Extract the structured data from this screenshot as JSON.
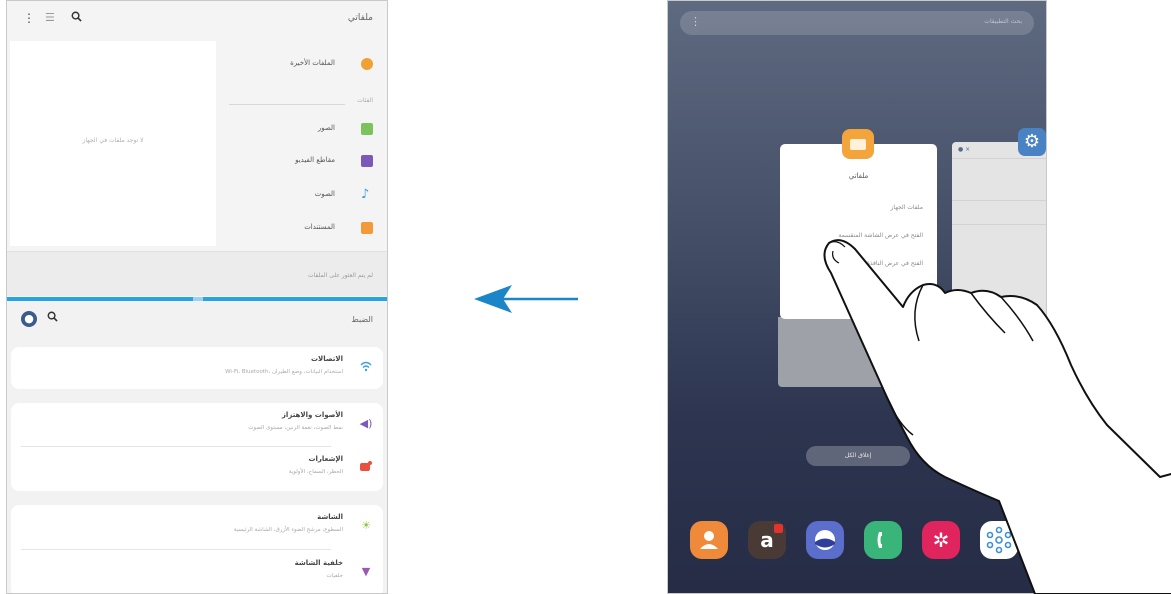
{
  "left_phone": {
    "files": {
      "title": "ملفاتي",
      "toolbar": {
        "more_icon": "more-vertical-icon",
        "list_icon": "list-view-icon",
        "search_icon": "search-icon"
      },
      "recent_label": "الملفات الأخيرة",
      "categories_header": "الفئات",
      "categories": [
        {
          "label": "الصور",
          "icon": "image-icon",
          "color": "#7cc35e"
        },
        {
          "label": "مقاطع الفيديو",
          "icon": "video-icon",
          "color": "#7b59b8"
        },
        {
          "label": "الصوت",
          "icon": "music-icon",
          "color": "#3c9ee5"
        },
        {
          "label": "المستندات",
          "icon": "document-icon",
          "color": "#f29a3a"
        }
      ],
      "preview_text": "لا توجد ملفات في الجهاز",
      "bottom_text": "لم يتم العثور على الملفات"
    },
    "settings": {
      "title": "الضبط",
      "cards": [
        {
          "items": [
            {
              "title": "الاتصالات",
              "subtitle": "Wi-Fi، Bluetooth، استخدام البيانات، وضع الطيران",
              "icon": "wifi-icon",
              "color": "#3c9ee5"
            }
          ]
        },
        {
          "items": [
            {
              "title": "الأصوات والاهتزاز",
              "subtitle": "نمط الصوت، نغمة الرنين، مستوى الصوت",
              "icon": "volume-icon",
              "color": "#7b59b8"
            },
            {
              "title": "الإشعارات",
              "subtitle": "الحظر، السماح، الأولوية",
              "icon": "notification-icon",
              "color": "#e9503f"
            }
          ]
        },
        {
          "items": [
            {
              "title": "الشاشة",
              "subtitle": "السطوع، مرشح الضوء الأزرق، الشاشة الرئيسية",
              "icon": "brightness-icon",
              "color": "#8cc63e"
            },
            {
              "title": "خلفية الشاشة",
              "subtitle": "خلفيات",
              "icon": "wallpaper-icon",
              "color": "#9b59b6"
            }
          ]
        }
      ]
    }
  },
  "arrow": {
    "color": "#1a86c8",
    "direction": "left"
  },
  "right_phone": {
    "search_placeholder": "بحث التطبيقات",
    "files_card": {
      "title": "ملفاتي",
      "lines": [
        "ملفات الجهاز",
        "الفتح في عرض الشاشة المنقسمة",
        "الفتح في عرض النافذة المنبثقة"
      ]
    },
    "close_all": "إغلاق الكل",
    "dock": [
      {
        "name": "contacts",
        "icon": "contacts-icon",
        "color": "#ee8a3a",
        "glyph": "👤"
      },
      {
        "name": "amazon",
        "icon": "amazon-icon",
        "color": "#4a3a35",
        "glyph": "a"
      },
      {
        "name": "internet",
        "icon": "internet-icon",
        "color": "#5b6ecc",
        "glyph": "◐"
      },
      {
        "name": "phone",
        "icon": "phone-icon",
        "color": "#39b57a",
        "glyph": "✆"
      },
      {
        "name": "galaxy-apps",
        "icon": "galaxy-apps-icon",
        "color": "#e0245e",
        "glyph": "✲"
      },
      {
        "name": "smartthings",
        "icon": "smartthings-icon",
        "color": "#ffffff",
        "glyph": "⚛"
      }
    ]
  }
}
